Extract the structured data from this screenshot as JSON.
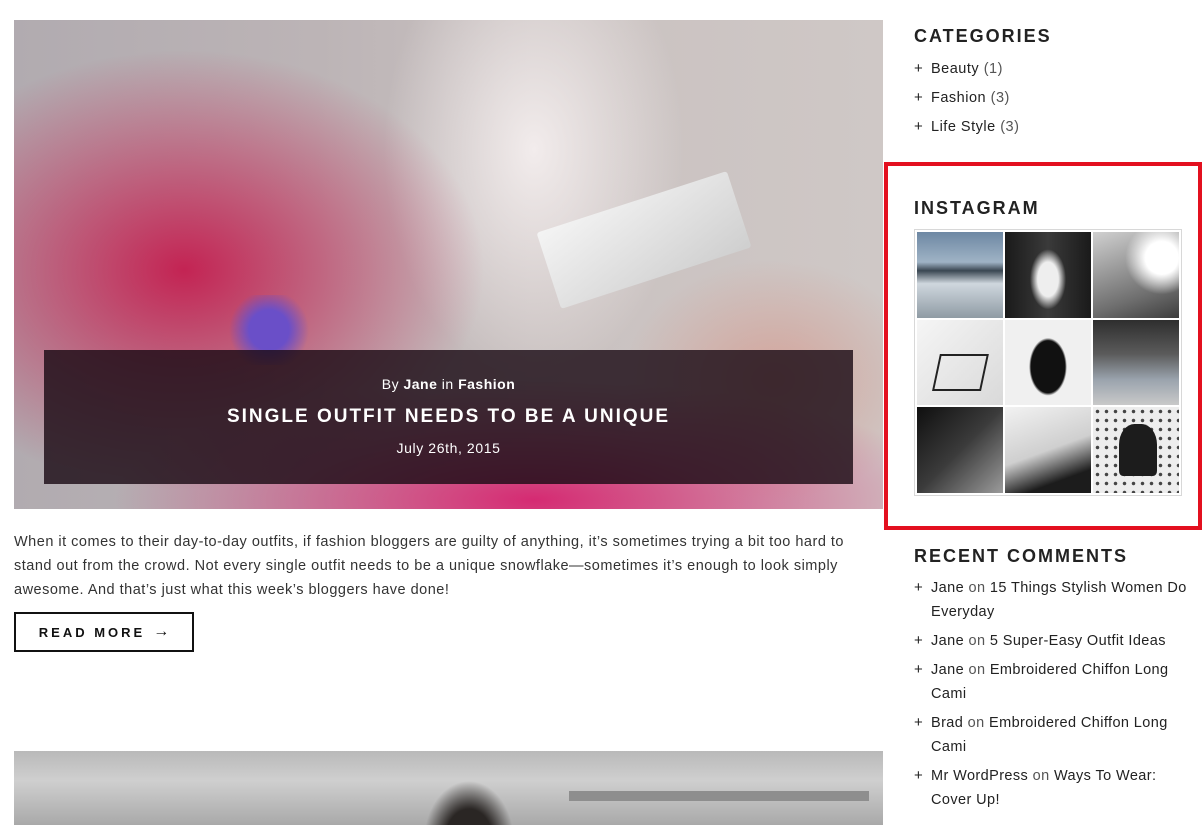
{
  "post": {
    "byline_prefix": "By",
    "author": "Jane",
    "in_word": "in",
    "category": "Fashion",
    "title": "SINGLE OUTFIT NEEDS TO BE A UNIQUE",
    "date": "July 26th, 2015",
    "excerpt": "When it comes to their day-to-day outfits, if fashion bloggers are guilty of anything, it’s sometimes trying a bit too hard to stand out from the crowd. Not every single outfit needs to be a unique snowflake—sometimes it’s enough to look simply awesome. And that’s just what this week’s bloggers have done!",
    "read_more": "READ MORE",
    "read_more_icon": "→"
  },
  "sidebar": {
    "categories": {
      "title": "CATEGORIES",
      "items": [
        {
          "label": "Beauty",
          "count": "(1)"
        },
        {
          "label": "Fashion",
          "count": "(3)"
        },
        {
          "label": "Life Style",
          "count": "(3)"
        }
      ]
    },
    "instagram": {
      "title": "INSTAGRAM",
      "highlight_color": "#e3101f"
    },
    "recent_comments": {
      "title": "RECENT COMMENTS",
      "on_word": "on",
      "items": [
        {
          "author": "Jane",
          "post": "15 Things Stylish Women Do Everyday"
        },
        {
          "author": "Jane",
          "post": "5 Super-Easy Outfit Ideas"
        },
        {
          "author": "Jane",
          "post": "Embroidered Chiffon Long Cami"
        },
        {
          "author": "Brad",
          "post": "Embroidered Chiffon Long Cami"
        },
        {
          "author": "Mr WordPress",
          "post": "Ways To Wear: Cover Up!"
        }
      ]
    }
  },
  "icons": {
    "list_bullet": "+"
  }
}
